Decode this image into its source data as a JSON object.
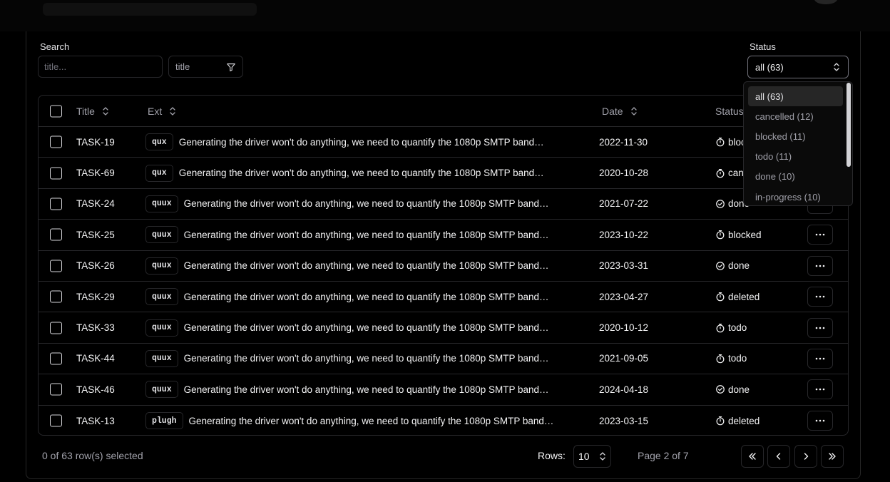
{
  "filters": {
    "search_label": "Search",
    "search_placeholder": "title...",
    "field_value": "title",
    "status_label": "Status",
    "status_value": "all (63)"
  },
  "columns": {
    "title": "Title",
    "ext": "Ext",
    "date": "Date",
    "status": "Status"
  },
  "rows": [
    {
      "id": "TASK-19",
      "ext": "qux",
      "title": "Generating the driver won't do anything, we need to quantify the 1080p SMTP bandwidth!",
      "date": "2022-11-30",
      "status": "blocked",
      "status_icon": "timer-icon"
    },
    {
      "id": "TASK-69",
      "ext": "qux",
      "title": "Generating the driver won't do anything, we need to quantify the 1080p SMTP bandwidth!",
      "date": "2020-10-28",
      "status": "cancelled",
      "status_icon": "timer-icon"
    },
    {
      "id": "TASK-24",
      "ext": "quux",
      "title": "Generating the driver won't do anything, we need to quantify the 1080p SMTP bandwidth!",
      "date": "2021-07-22",
      "status": "done",
      "status_icon": "check-circle-icon"
    },
    {
      "id": "TASK-25",
      "ext": "quux",
      "title": "Generating the driver won't do anything, we need to quantify the 1080p SMTP bandwidth!",
      "date": "2023-10-22",
      "status": "blocked",
      "status_icon": "timer-icon"
    },
    {
      "id": "TASK-26",
      "ext": "quux",
      "title": "Generating the driver won't do anything, we need to quantify the 1080p SMTP bandwidth!",
      "date": "2023-03-31",
      "status": "done",
      "status_icon": "check-circle-icon"
    },
    {
      "id": "TASK-29",
      "ext": "quux",
      "title": "Generating the driver won't do anything, we need to quantify the 1080p SMTP bandwidth!",
      "date": "2023-04-27",
      "status": "deleted",
      "status_icon": "timer-icon"
    },
    {
      "id": "TASK-33",
      "ext": "quux",
      "title": "Generating the driver won't do anything, we need to quantify the 1080p SMTP bandwidth!",
      "date": "2020-10-12",
      "status": "todo",
      "status_icon": "timer-icon"
    },
    {
      "id": "TASK-44",
      "ext": "quux",
      "title": "Generating the driver won't do anything, we need to quantify the 1080p SMTP bandwidth!",
      "date": "2021-09-05",
      "status": "todo",
      "status_icon": "timer-icon"
    },
    {
      "id": "TASK-46",
      "ext": "quux",
      "title": "Generating the driver won't do anything, we need to quantify the 1080p SMTP bandwidth!",
      "date": "2024-04-18",
      "status": "done",
      "status_icon": "check-circle-icon"
    },
    {
      "id": "TASK-13",
      "ext": "plugh",
      "title": "Generating the driver won't do anything, we need to quantify the 1080p SMTP bandwidth!",
      "date": "2023-03-15",
      "status": "deleted",
      "status_icon": "timer-icon"
    }
  ],
  "footer": {
    "selected_text": "0 of 63 row(s) selected",
    "rows_label": "Rows:",
    "rows_value": "10",
    "page_text": "Page 2 of 7"
  },
  "status_dropdown": {
    "options": [
      "all (63)",
      "cancelled (12)",
      "blocked (11)",
      "todo (11)",
      "done (10)",
      "in-progress (10)"
    ],
    "selected": "all (63)"
  }
}
